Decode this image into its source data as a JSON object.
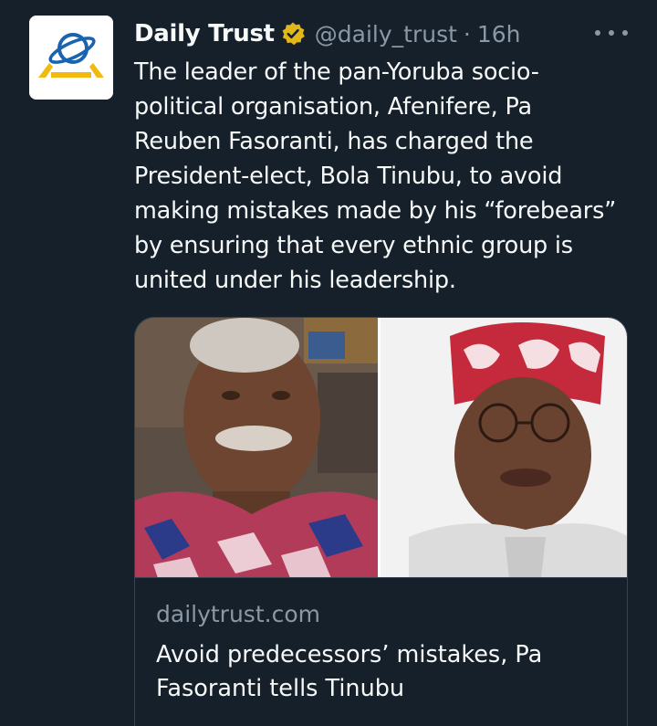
{
  "tweet": {
    "display_name": "Daily Trust",
    "handle": "@daily_trust",
    "separator": "·",
    "time": "16h",
    "text_lines": [
      "The leader of the pan-Yoruba socio-",
      "political organisation, Afenifere, Pa",
      "Reuben Fasoranti, has charged the",
      "President-elect, Bola Tinubu, to avoid",
      "making mistakes made by his “forebears”",
      "by ensuring that every ethnic group is",
      "united under his leadership."
    ],
    "avatar_icon": "daily-trust-logo-icon",
    "verified_icon": "gold-verified-badge-icon",
    "more_icon": "more-options-icon"
  },
  "card": {
    "domain": "dailytrust.com",
    "title_lines": [
      "Avoid predecessors’ mistakes, Pa",
      "Fasoranti tells Tinubu"
    ]
  },
  "colors": {
    "background": "#15202b",
    "text": "#f7f9f9",
    "secondary": "#8b98a5",
    "border": "#38444d",
    "verified_gold": "#e2b719",
    "logo_blue": "#1a63b0",
    "logo_yellow": "#f2b90f"
  }
}
